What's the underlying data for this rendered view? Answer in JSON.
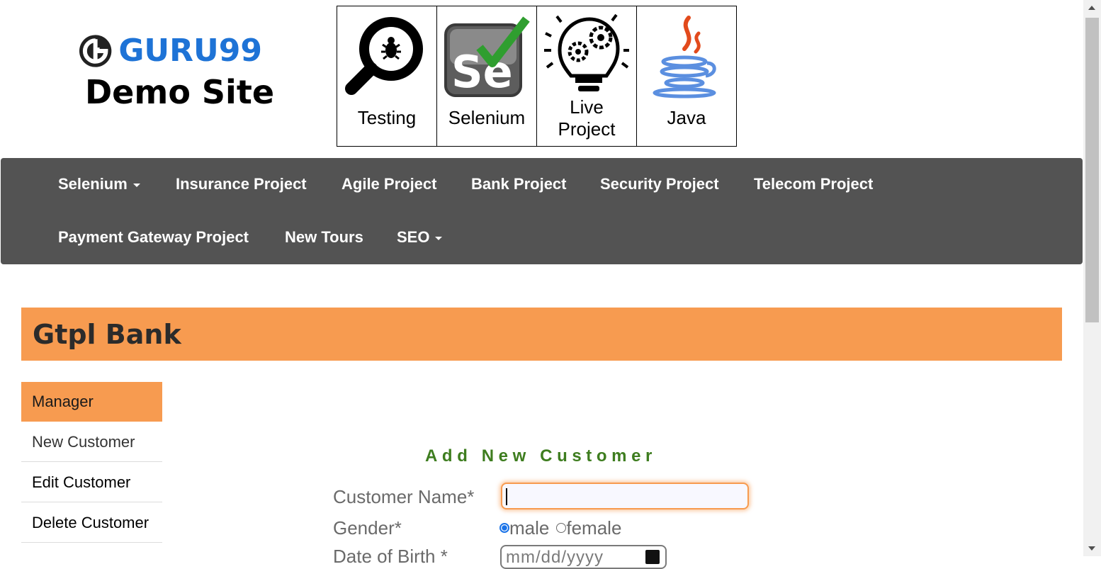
{
  "header": {
    "logo_text": "GURU99",
    "site_title": "Demo Site",
    "tiles": [
      {
        "label": "Testing",
        "icon": "magnifier-bug-icon"
      },
      {
        "label": "Selenium",
        "icon": "selenium-check-icon"
      },
      {
        "label": "Live Project",
        "icon": "lightbulb-gears-icon"
      },
      {
        "label": "Java",
        "icon": "java-cup-icon"
      }
    ]
  },
  "nav": {
    "items": [
      "Selenium",
      "Insurance Project",
      "Agile Project",
      "Bank Project",
      "Security Project",
      "Telecom Project",
      "Payment Gateway Project",
      "New Tours",
      "SEO"
    ]
  },
  "bank": {
    "title": "Gtpl Bank",
    "sidebar": [
      "Manager",
      "New Customer",
      "Edit Customer",
      "Delete Customer"
    ]
  },
  "form": {
    "title": "Add New Customer",
    "customer_name_label": "Customer Name*",
    "customer_name_value": "",
    "gender_label": "Gender*",
    "gender_options": [
      "male",
      "female"
    ],
    "gender_selected": "male",
    "dob_label": "Date of Birth *",
    "dob_placeholder": "mm/dd/yyyy"
  },
  "colors": {
    "brand_blue": "#1e73d6",
    "nav_bg": "#535353",
    "bank_orange": "#f79b50",
    "form_title_green": "#3e7d1f"
  }
}
